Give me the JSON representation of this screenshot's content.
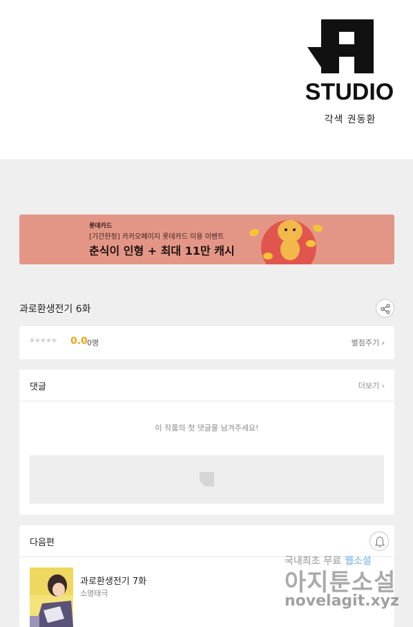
{
  "header": {
    "logo_text": "STUDIO",
    "credit": "각색 권동환"
  },
  "banner": {
    "line1": "롯데카드",
    "line2": "[기간한정] 카카오페이지 롯데카드 이용 이벤트",
    "line3": "춘식이 인형 + 최대 11만 캐시",
    "background": "#e49686"
  },
  "episode": {
    "title": "과로환생전기 6화"
  },
  "rating": {
    "stars": "★★★★★",
    "score": "0.0",
    "count": "0명",
    "rate_link": "별점주기 ›",
    "score_color": "#f0a41a"
  },
  "comments": {
    "label": "댓글",
    "more": "더보기 ›",
    "empty_message": "이 작품의 첫 댓글을 남겨주세요!"
  },
  "next": {
    "label": "다음편",
    "title": "과로환생전기 7화",
    "author": "소명태극"
  },
  "watermark": {
    "line1_a": "국내최초 무료 ",
    "line1_b": "웹소설",
    "line2": "아지툰소설",
    "line3": "novelagit.xyz"
  }
}
